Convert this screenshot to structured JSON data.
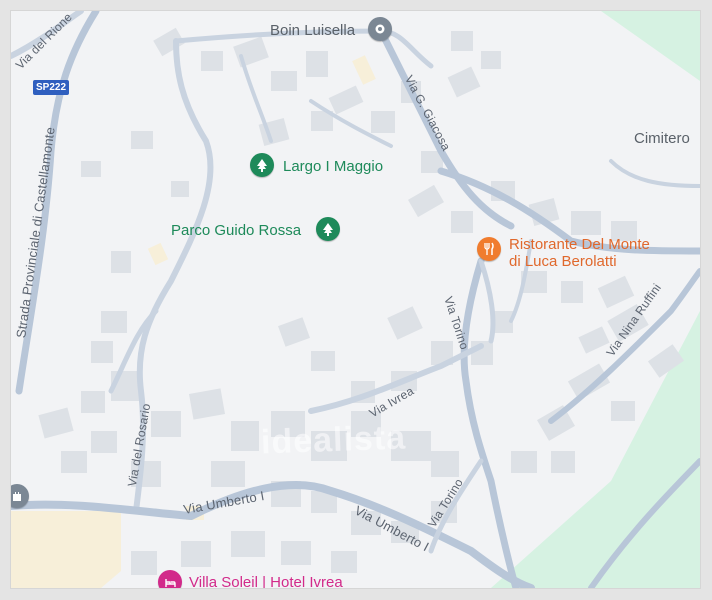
{
  "map": {
    "colors": {
      "land": "#f2f3f5",
      "park": "#d6f2e2",
      "road": "#c9d3e0",
      "road_major": "#b8c6d8",
      "building": "#dde1e6",
      "beige": "#f7efd9"
    },
    "pois": {
      "boin": {
        "label": "Boin Luisella",
        "icon": "location-pin-icon"
      },
      "largo": {
        "label": "Largo I Maggio",
        "icon": "tree-icon"
      },
      "parco": {
        "label": "Parco Guido Rossa",
        "icon": "tree-icon"
      },
      "ristorante": {
        "line1": "Ristorante Del Monte",
        "line2": "di Luca Berolatti",
        "icon": "restaurant-icon"
      },
      "cimitero": {
        "label": "Cimitero"
      },
      "villa": {
        "label": "Villa Soleil | Hotel Ivrea",
        "icon": "hotel-icon"
      }
    },
    "streets": {
      "sp222_badge": "SP222",
      "provinciale": "Strada Provinciale di Castellamonte",
      "rione": "Via del Rione",
      "giacosa": "Via G. Giacosa",
      "torino_upper": "Via Torino",
      "torino_lower": "Via Torino",
      "nina_ruffini": "Via Nina Ruffini",
      "ivrea": "Via Ivrea",
      "rosario": "Via del Rosario",
      "umberto_left": "Via Umberto I",
      "umberto_right": "Via Umberto I"
    },
    "watermark": "idealista"
  }
}
